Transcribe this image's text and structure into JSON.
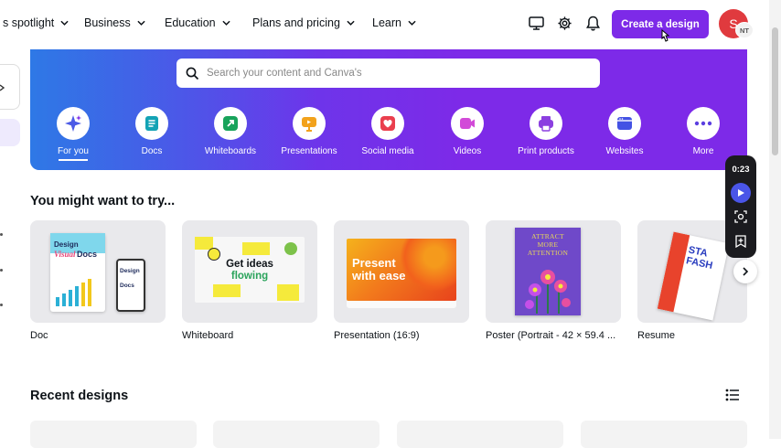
{
  "nav": {
    "items": [
      {
        "label": "s spotlight"
      },
      {
        "label": "Business"
      },
      {
        "label": "Education"
      },
      {
        "label": "Plans and pricing"
      },
      {
        "label": "Learn"
      }
    ],
    "create_label": "Create a design",
    "avatar_initial": "S",
    "avatar_team": "NT"
  },
  "search": {
    "placeholder": "Search your content and Canva's"
  },
  "categories": [
    {
      "label": "For you",
      "icon": "sparkle-icon"
    },
    {
      "label": "Docs",
      "icon": "doc-icon"
    },
    {
      "label": "Whiteboards",
      "icon": "whiteboard-icon"
    },
    {
      "label": "Presentations",
      "icon": "presentation-icon"
    },
    {
      "label": "Social media",
      "icon": "heart-icon"
    },
    {
      "label": "Videos",
      "icon": "video-icon"
    },
    {
      "label": "Print products",
      "icon": "printer-icon"
    },
    {
      "label": "Websites",
      "icon": "website-icon"
    },
    {
      "label": "More",
      "icon": "more-icon"
    }
  ],
  "suggest": {
    "title": "You might want to try...",
    "tiles": [
      {
        "label": "Doc",
        "thumb_line1": "Design",
        "thumb_line2": "Visual",
        "thumb_line3": "Docs"
      },
      {
        "label": "Whiteboard",
        "thumb_line1": "Get ideas",
        "thumb_line2": "flowing"
      },
      {
        "label": "Presentation (16:9)",
        "thumb_line1": "Present",
        "thumb_line2": "with ease"
      },
      {
        "label": "Poster (Portrait - 42 × 59.4 ...",
        "thumb_line1": "ATTRACT",
        "thumb_line2": "MORE",
        "thumb_line3": "ATTENTION"
      },
      {
        "label": "Resume",
        "thumb_line1": "STA",
        "thumb_line2": "FASH"
      }
    ]
  },
  "recent": {
    "title": "Recent designs"
  },
  "recorder": {
    "time": "0:23"
  },
  "colors": {
    "accent": "#7d2ae8",
    "hero_start": "#4950e6",
    "avatar": "#e03a3e"
  }
}
